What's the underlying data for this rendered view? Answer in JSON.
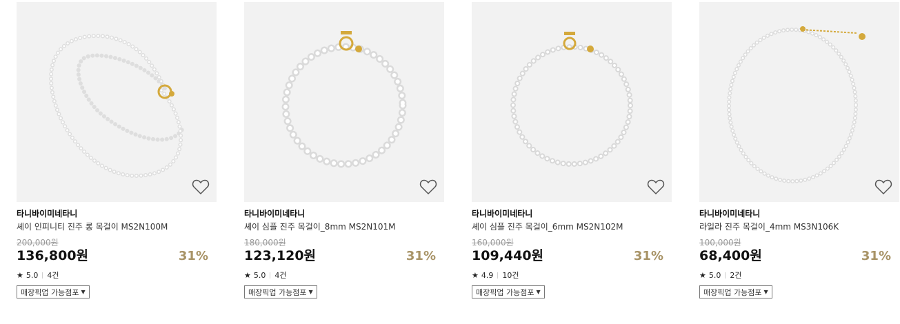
{
  "products": [
    {
      "brand": "타니바이미네타니",
      "name": "셰이 인피니티 진주 롱 목걸이 MS2N100M",
      "original_price": "200,000원",
      "price": "136,800원",
      "discount": "31%",
      "rating": "5.0",
      "review_count": "4건",
      "pickup_label": "매장픽업 가능점포",
      "wish_icon": "heart-outline-icon"
    },
    {
      "brand": "타니바이미네타니",
      "name": "셰이 심플 진주 목걸이_8mm MS2N101M",
      "original_price": "180,000원",
      "price": "123,120원",
      "discount": "31%",
      "rating": "5.0",
      "review_count": "4건",
      "pickup_label": "매장픽업 가능점포",
      "wish_icon": "heart-outline-icon"
    },
    {
      "brand": "타니바이미네타니",
      "name": "셰이 심플 진주 목걸이_6mm MS2N102M",
      "original_price": "160,000원",
      "price": "109,440원",
      "discount": "31%",
      "rating": "4.9",
      "review_count": "10건",
      "pickup_label": "매장픽업 가능점포",
      "wish_icon": "heart-outline-icon"
    },
    {
      "brand": "타니바이미네타니",
      "name": "라일라 진주 목걸이_4mm MS3N106K",
      "original_price": "100,000원",
      "price": "68,400원",
      "discount": "31%",
      "rating": "5.0",
      "review_count": "2건",
      "pickup_label": "매장픽업 가능점포",
      "wish_icon": "heart-outline-icon"
    }
  ],
  "colors": {
    "discount": "#a89366",
    "image_bg": "#f2f2f2",
    "gold": "#d4a93c"
  }
}
